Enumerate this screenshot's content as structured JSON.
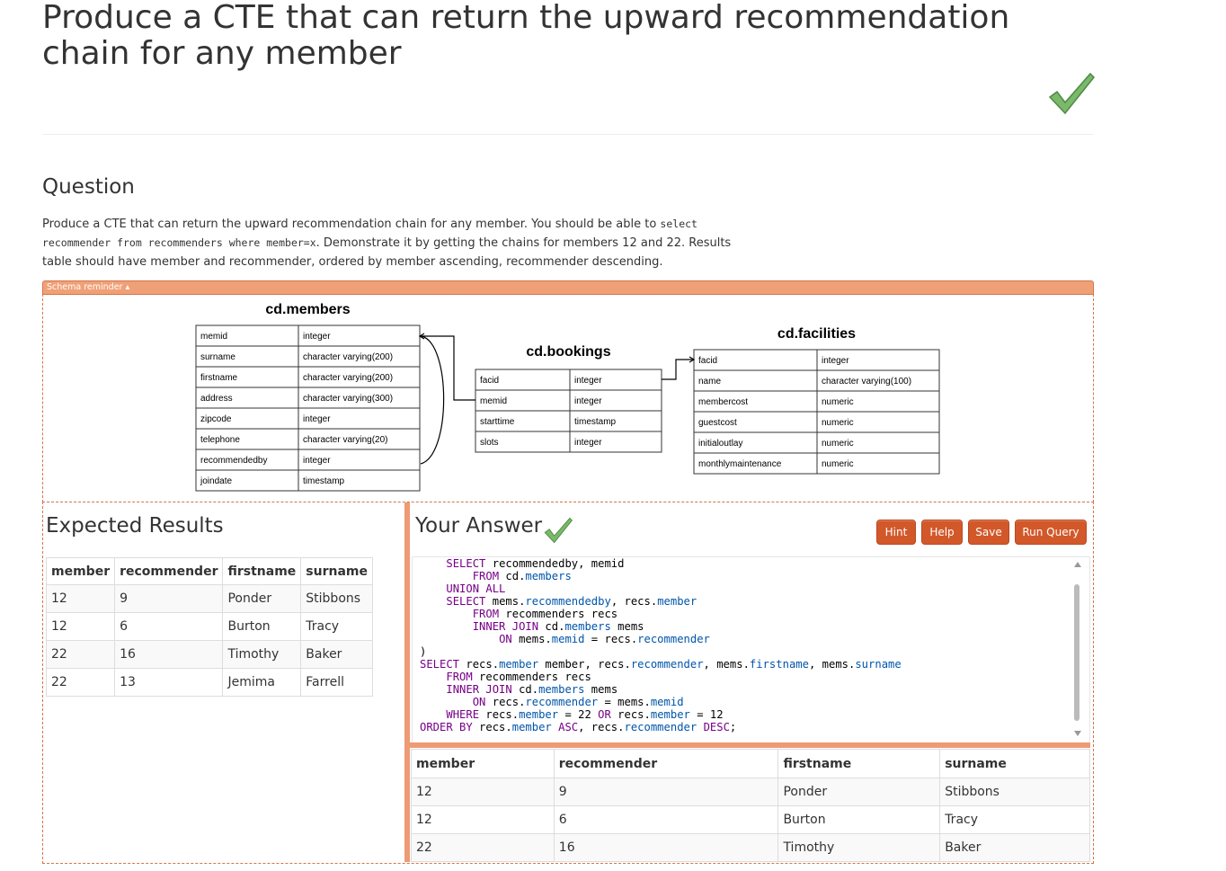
{
  "page": {
    "title": "Produce a CTE that can return the upward recommendation chain for any member"
  },
  "question": {
    "heading": "Question",
    "text_1": "Produce a CTE that can return the upward recommendation chain for any member. You should be able to ",
    "code_1": "select recommender from recommenders where member=x",
    "text_2": ". Demonstrate it by getting the chains for members 12 and 22. Results table should have member and recommender, ordered by member ascending, recommender descending."
  },
  "schema": {
    "toggle_label": "Schema reminder ▴",
    "members": {
      "title": "cd.members",
      "rows": [
        [
          "memid",
          "integer"
        ],
        [
          "surname",
          "character varying(200)"
        ],
        [
          "firstname",
          "character varying(200)"
        ],
        [
          "address",
          "character varying(300)"
        ],
        [
          "zipcode",
          "integer"
        ],
        [
          "telephone",
          "character varying(20)"
        ],
        [
          "recommendedby",
          "integer"
        ],
        [
          "joindate",
          "timestamp"
        ]
      ]
    },
    "bookings": {
      "title": "cd.bookings",
      "rows": [
        [
          "facid",
          "integer"
        ],
        [
          "memid",
          "integer"
        ],
        [
          "starttime",
          "timestamp"
        ],
        [
          "slots",
          "integer"
        ]
      ]
    },
    "facilities": {
      "title": "cd.facilities",
      "rows": [
        [
          "facid",
          "integer"
        ],
        [
          "name",
          "character varying(100)"
        ],
        [
          "membercost",
          "numeric"
        ],
        [
          "guestcost",
          "numeric"
        ],
        [
          "initialoutlay",
          "numeric"
        ],
        [
          "monthlymaintenance",
          "numeric"
        ]
      ]
    }
  },
  "expected": {
    "heading": "Expected Results",
    "columns": [
      "member",
      "recommender",
      "firstname",
      "surname"
    ],
    "rows": [
      [
        "12",
        "9",
        "Ponder",
        "Stibbons"
      ],
      [
        "12",
        "6",
        "Burton",
        "Tracy"
      ],
      [
        "22",
        "16",
        "Timothy",
        "Baker"
      ],
      [
        "22",
        "13",
        "Jemima",
        "Farrell"
      ]
    ]
  },
  "answer": {
    "heading": "Your Answer",
    "buttons": {
      "hint": "Hint",
      "help": "Help",
      "save": "Save",
      "run": "Run Query"
    },
    "code_lines": [
      [
        [
          "    ",
          ""
        ],
        [
          "SELECT",
          "kw"
        ],
        [
          " recommendedby, memid",
          ""
        ]
      ],
      [
        [
          "        ",
          ""
        ],
        [
          "FROM",
          "kw"
        ],
        [
          " cd.",
          ""
        ],
        [
          "members",
          "tbl"
        ]
      ],
      [
        [
          "    ",
          ""
        ],
        [
          "UNION ALL",
          "kw"
        ]
      ],
      [
        [
          "    ",
          ""
        ],
        [
          "SELECT",
          "kw"
        ],
        [
          " mems.",
          ""
        ],
        [
          "recommendedby",
          "tbl"
        ],
        [
          ", recs.",
          ""
        ],
        [
          "member",
          "tbl"
        ]
      ],
      [
        [
          "        ",
          ""
        ],
        [
          "FROM",
          "kw"
        ],
        [
          " recommenders recs",
          ""
        ]
      ],
      [
        [
          "        ",
          ""
        ],
        [
          "INNER JOIN",
          "kw"
        ],
        [
          " cd.",
          ""
        ],
        [
          "members",
          "tbl"
        ],
        [
          " mems",
          ""
        ]
      ],
      [
        [
          "            ",
          ""
        ],
        [
          "ON",
          "kw"
        ],
        [
          " mems.",
          ""
        ],
        [
          "memid",
          "tbl"
        ],
        [
          " = recs.",
          ""
        ],
        [
          "recommender",
          "tbl"
        ]
      ],
      [
        [
          ")",
          ""
        ]
      ],
      [
        [
          "SELECT",
          "kw"
        ],
        [
          " recs.",
          ""
        ],
        [
          "member",
          "tbl"
        ],
        [
          " member, recs.",
          ""
        ],
        [
          "recommender",
          "tbl"
        ],
        [
          ", mems.",
          ""
        ],
        [
          "firstname",
          "tbl"
        ],
        [
          ", mems.",
          ""
        ],
        [
          "surname",
          "tbl"
        ]
      ],
      [
        [
          "    ",
          ""
        ],
        [
          "FROM",
          "kw"
        ],
        [
          " recommenders recs",
          ""
        ]
      ],
      [
        [
          "    ",
          ""
        ],
        [
          "INNER JOIN",
          "kw"
        ],
        [
          " cd.",
          ""
        ],
        [
          "members",
          "tbl"
        ],
        [
          " mems",
          ""
        ]
      ],
      [
        [
          "        ",
          ""
        ],
        [
          "ON",
          "kw"
        ],
        [
          " recs.",
          ""
        ],
        [
          "recommender",
          "tbl"
        ],
        [
          " = mems.",
          ""
        ],
        [
          "memid",
          "tbl"
        ]
      ],
      [
        [
          "    ",
          ""
        ],
        [
          "WHERE",
          "kw"
        ],
        [
          " recs.",
          ""
        ],
        [
          "member",
          "tbl"
        ],
        [
          " = 22 ",
          ""
        ],
        [
          "OR",
          "kw"
        ],
        [
          " recs.",
          ""
        ],
        [
          "member",
          "tbl"
        ],
        [
          " = 12",
          ""
        ]
      ],
      [
        [
          "ORDER BY",
          "kw"
        ],
        [
          " recs.",
          ""
        ],
        [
          "member",
          "tbl"
        ],
        [
          " ",
          ""
        ],
        [
          "ASC",
          "kw"
        ],
        [
          ", recs.",
          ""
        ],
        [
          "recommender",
          "tbl"
        ],
        [
          " ",
          ""
        ],
        [
          "DESC",
          "kw"
        ],
        [
          ";",
          ""
        ]
      ]
    ],
    "result_columns": [
      "member",
      "recommender",
      "firstname",
      "surname"
    ],
    "result_rows": [
      [
        "12",
        "9",
        "Ponder",
        "Stibbons"
      ],
      [
        "12",
        "6",
        "Burton",
        "Tracy"
      ],
      [
        "22",
        "16",
        "Timothy",
        "Baker"
      ]
    ]
  },
  "colors": {
    "accent": "#d2582a",
    "accent_light": "#ee9a74",
    "check_green": "#6aaa5a"
  }
}
